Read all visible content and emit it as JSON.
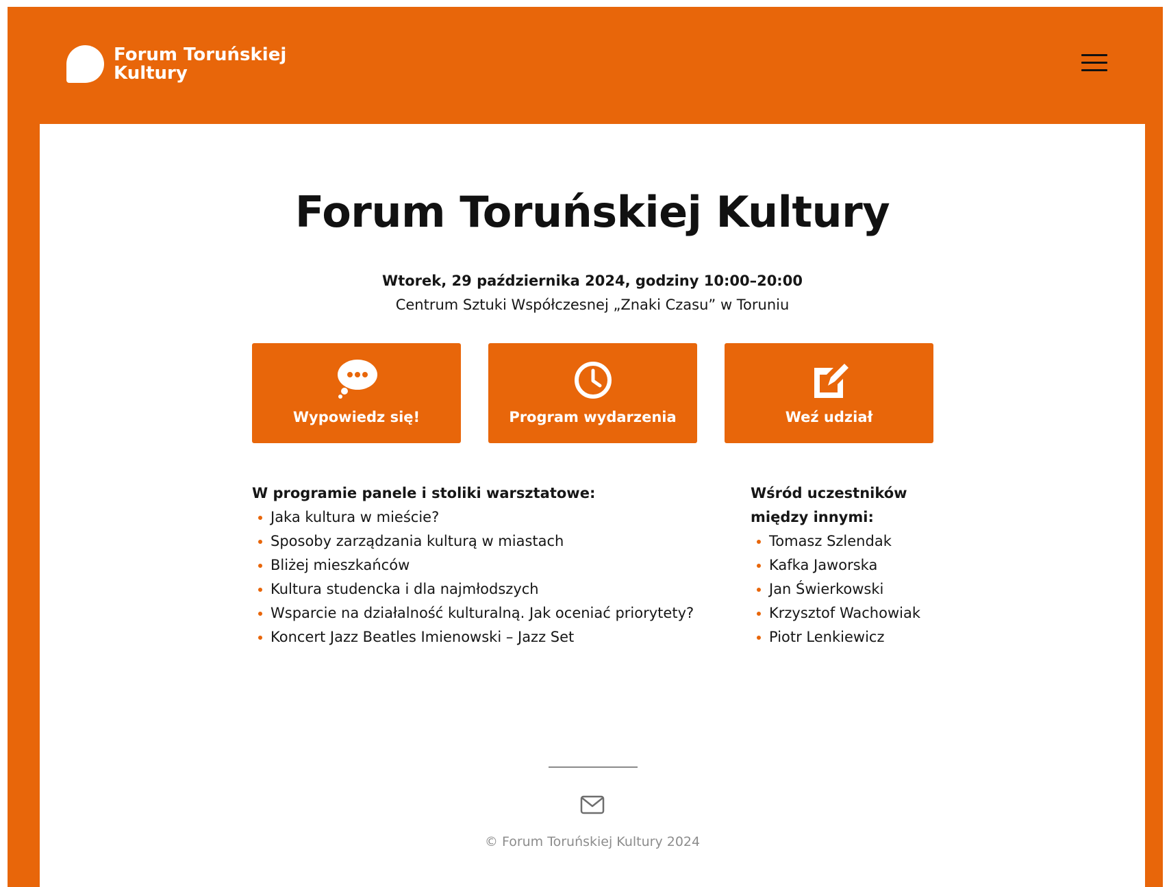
{
  "header": {
    "logo_line1": "Forum Toruńskiej",
    "logo_line2": "Kultury",
    "menu_icon": "hamburger-menu-icon"
  },
  "main": {
    "title": "Forum Toruńskiej Kultury",
    "date": "Wtorek, 29 października 2024, godziny 10:00–20:00",
    "venue": "Centrum Sztuki Współczesnej „Znaki Czasu” w Toruniu"
  },
  "actions": [
    {
      "label": "Wypowiedz się!",
      "icon": "speech-bubble-icon"
    },
    {
      "label": "Program wydarzenia",
      "icon": "clock-icon"
    },
    {
      "label": "Weź udział",
      "icon": "edit-icon"
    }
  ],
  "program": {
    "heading": "W programie panele i stoliki warsztatowe:",
    "items": [
      "Jaka kultura w mieście?",
      "Sposoby zarządzania kulturą w miastach",
      "Bliżej mieszkańców",
      "Kultura studencka i dla najmłodszych",
      "Wsparcie na działalność kulturalną. Jak oceniać priorytety?",
      "Koncert Jazz Beatles Imienowski – Jazz Set"
    ]
  },
  "participants": {
    "heading_line1": "Wśród uczestników",
    "heading_line2": "między innymi:",
    "items": [
      "Tomasz Szlendak",
      "Kafka Jaworska",
      "Jan Świerkowski",
      "Krzysztof Wachowiak",
      "Piotr Lenkiewicz"
    ]
  },
  "footer": {
    "mail_icon": "envelope-icon",
    "copyright": "© Forum Toruńskiej Kultury 2024"
  },
  "colors": {
    "brand": "#e8660a",
    "text": "#161616",
    "muted": "#8c8c8c"
  }
}
